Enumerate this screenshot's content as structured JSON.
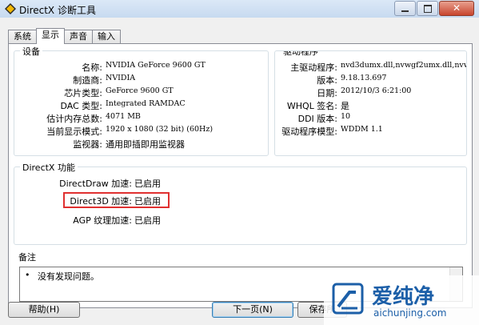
{
  "window": {
    "title": "DirectX 诊断工具",
    "close_glyph": "✕"
  },
  "tabs": [
    {
      "label": "系统",
      "active": false
    },
    {
      "label": "显示",
      "active": true
    },
    {
      "label": "声音",
      "active": false
    },
    {
      "label": "输入",
      "active": false
    }
  ],
  "device": {
    "title": "设备",
    "rows": [
      {
        "label": "名称:",
        "value": "NVIDIA GeForce 9600 GT"
      },
      {
        "label": "制造商:",
        "value": "NVIDIA"
      },
      {
        "label": "芯片类型:",
        "value": "GeForce 9600 GT"
      },
      {
        "label": "DAC 类型:",
        "value": "Integrated RAMDAC"
      },
      {
        "label": "估计内存总数:",
        "value": "4071 MB"
      },
      {
        "label": "当前显示模式:",
        "value": "1920 x 1080 (32 bit) (60Hz)"
      },
      {
        "label": "监视器:",
        "value": "通用即插即用监视器"
      }
    ]
  },
  "driver": {
    "title": "驱动程序",
    "rows": [
      {
        "label": "主驱动程序:",
        "value": "nvd3dumx.dll,nvwgf2umx.dll,nvw"
      },
      {
        "label": "版本:",
        "value": "9.18.13.697"
      },
      {
        "label": "日期:",
        "value": "2012/10/3 6:21:00"
      },
      {
        "label": "WHQL 签名:",
        "value": "是"
      },
      {
        "label": "DDI 版本:",
        "value": "10"
      },
      {
        "label": "驱动程序模型:",
        "value": "WDDM 1.1"
      }
    ]
  },
  "directx": {
    "title": "DirectX 功能",
    "rows": [
      {
        "label": "DirectDraw 加速:",
        "value": "已启用"
      },
      {
        "label": "Direct3D 加速:",
        "value": "已启用"
      },
      {
        "label": "AGP 纹理加速:",
        "value": "已启用"
      }
    ]
  },
  "notes": {
    "title": "备注",
    "bullet": "•",
    "text": "没有发现问题。"
  },
  "buttons": {
    "help": "帮助(H)",
    "next": "下一页(N)",
    "save": "保存所"
  },
  "watermark": {
    "text": "爱纯净",
    "url": "aichunjing.com"
  },
  "colors": {
    "highlight": "#e03030",
    "accent": "#3c7fb1"
  }
}
